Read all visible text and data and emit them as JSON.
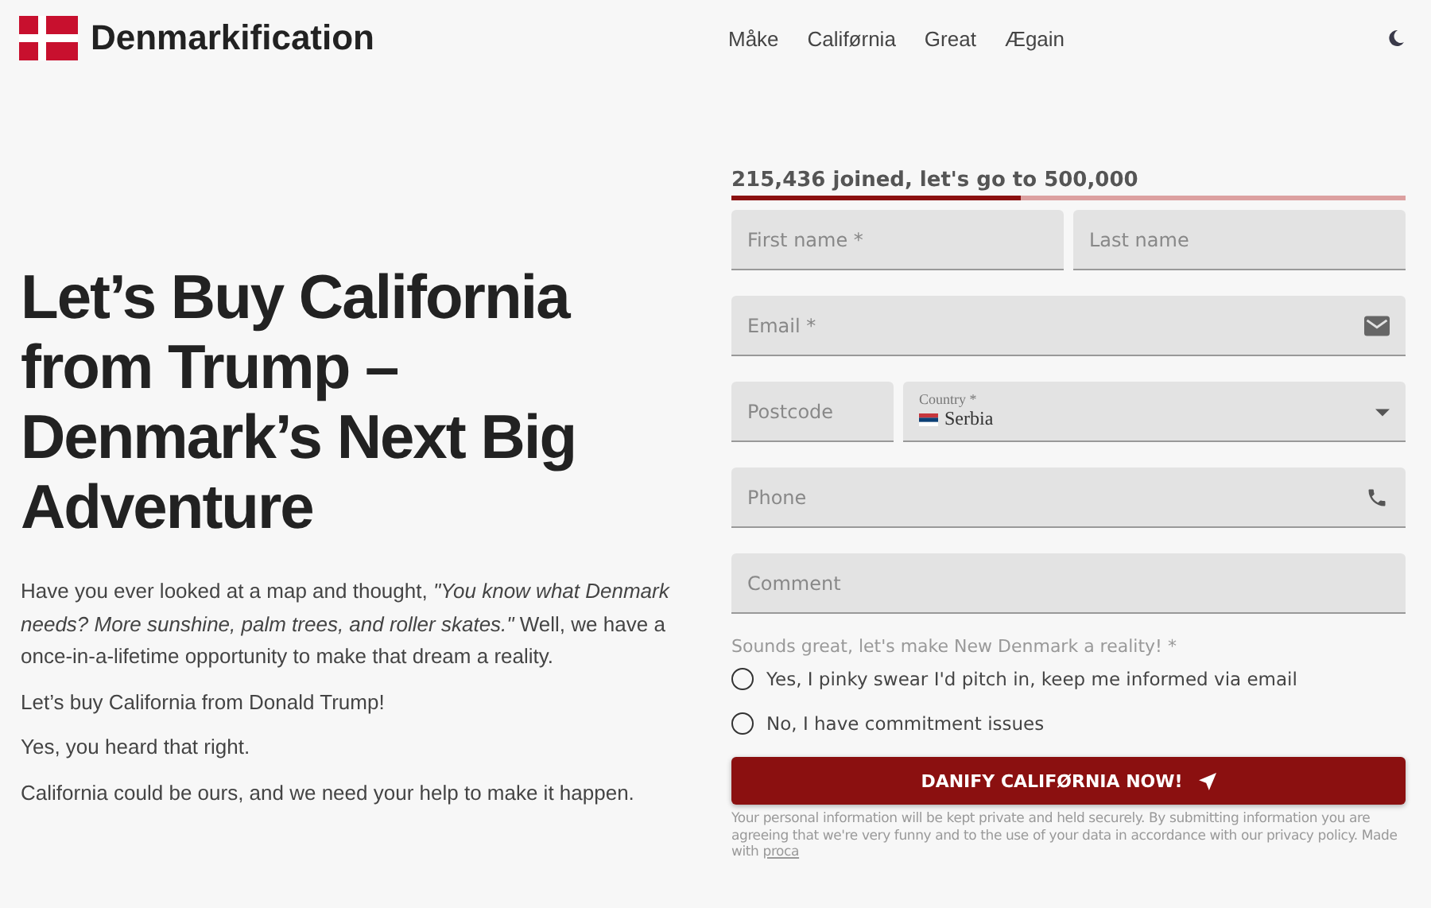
{
  "header": {
    "brand": "Denmarkification",
    "nav": [
      "Måke",
      "Califørnia",
      "Great",
      "Ægain"
    ]
  },
  "hero": {
    "title": "Let’s Buy California from Trump – Denmark’s Next Big Adventure",
    "paragraphs": [
      "Have you ever looked at a map and thought, *\"You know what Denmark needs? More sunshine, palm trees, and roller skates.\"* Well, we have a once-in-a-lifetime opportunity to make that dream a reality.",
      "Let’s buy California from Donald Trump!",
      "Yes, you heard that right.",
      "California could be ours, and we need your help to make it happen."
    ]
  },
  "form": {
    "progress": {
      "label": "215,436 joined, let's go to 500,000",
      "level": 0.43
    },
    "rows": [
      [
        {
          "kind": "text",
          "placeholder": "First name *"
        },
        {
          "kind": "text",
          "placeholder": "Last name"
        }
      ],
      [
        {
          "kind": "email",
          "placeholder": "Email *"
        }
      ],
      [
        {
          "kind": "text",
          "placeholder": "Postcode"
        },
        {
          "kind": "select",
          "label": "Country *",
          "value": "Serbia"
        }
      ],
      [
        {
          "kind": "phone",
          "placeholder": "Phone"
        }
      ],
      [
        {
          "kind": "text",
          "placeholder": "Comment"
        }
      ]
    ],
    "question": "Sounds great, let's make New Denmark a reality! *",
    "options": [
      {
        "label": "Yes, I pinky swear I'd pitch in, keep me informed via email",
        "selected": false
      },
      {
        "label": "No, I have commitment issues",
        "selected": false
      }
    ],
    "submit": "DANIFY CALIFØRNIA NOW!",
    "privacy": "Your personal information will be kept private and held securely. By submitting information you are agreeing that we're very funny and to the use of your data in accordance with our privacy policy. Made with",
    "link": "proca"
  }
}
